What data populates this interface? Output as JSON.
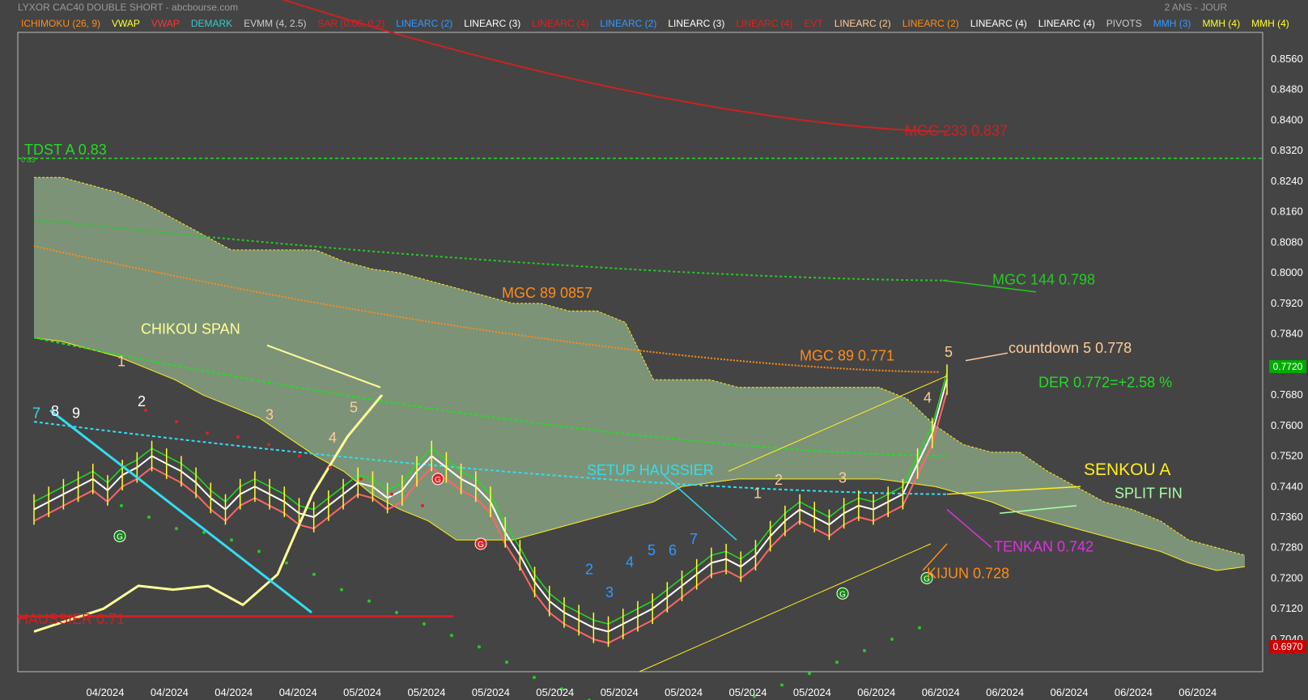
{
  "header": {
    "title": "LYXOR CAC40 DOUBLE SHORT - abcbourse.com",
    "period": "2 ANS - JOUR"
  },
  "legend": [
    {
      "label": "ICHIMOKU (26, 9)",
      "color": "#ff8c1a"
    },
    {
      "label": "VWAP",
      "color": "#ffff33"
    },
    {
      "label": "VWAP",
      "color": "#ff3333"
    },
    {
      "label": "DEMARK",
      "color": "#33cccc"
    },
    {
      "label": "EVMM (4, 2.5)",
      "color": "#cccccc"
    },
    {
      "label": "SAR (0.06, 0.2)",
      "color": "#dd2222"
    },
    {
      "label": "LINEARC (2)",
      "color": "#3399ff"
    },
    {
      "label": "LINEARC (3)",
      "color": "#ffffff"
    },
    {
      "label": "LINEARC (4)",
      "color": "#dd2222"
    },
    {
      "label": "LINEARC (2)",
      "color": "#3399ff"
    },
    {
      "label": "LINEARC (3)",
      "color": "#ffffff"
    },
    {
      "label": "LINEARC (4)",
      "color": "#dd2222"
    },
    {
      "label": "EVT",
      "color": "#dd2222"
    },
    {
      "label": "LINEARC (2)",
      "color": "#ffcc99"
    },
    {
      "label": "LINEARC (2)",
      "color": "#ff8c1a"
    },
    {
      "label": "LINEARC (4)",
      "color": "#ffffff"
    },
    {
      "label": "LINEARC (4)",
      "color": "#ffffff"
    },
    {
      "label": "PIVOTS",
      "color": "#cccccc"
    },
    {
      "label": "MMH (3)",
      "color": "#3399ff"
    },
    {
      "label": "MMH (4)",
      "color": "#ffff33"
    },
    {
      "label": "MMH (4)",
      "color": "#ffff33"
    }
  ],
  "price_badges": {
    "current": "0.7720",
    "current_color": "#00aa00",
    "low": "0.6970",
    "low_color": "#cc0000"
  },
  "chart_data": {
    "type": "line",
    "y_axis_ticks": [
      0.856,
      0.848,
      0.84,
      0.832,
      0.824,
      0.816,
      0.808,
      0.8,
      0.792,
      0.784,
      0.776,
      0.768,
      0.76,
      0.752,
      0.744,
      0.736,
      0.728,
      0.72,
      0.712,
      0.704
    ],
    "y_tick_labels": [
      "0.8560",
      "0.8480",
      "0.8400",
      "0.8320",
      "0.8240",
      "0.8160",
      "0.8080",
      "0.8000",
      "0.7920",
      "0.7840",
      "0.7760",
      "0.7680",
      "0.7600",
      "0.7520",
      "0.7440",
      "0.7360",
      "0.7280",
      "0.7200",
      "0.7120",
      "0.7040"
    ],
    "ylim": [
      0.6955,
      0.863
    ],
    "x_tick_labels": [
      "04/2024",
      "04/2024",
      "04/2024",
      "04/2024",
      "05/2024",
      "05/2024",
      "05/2024",
      "05/2024",
      "05/2024",
      "05/2024",
      "05/2024",
      "05/2024",
      "06/2024",
      "06/2024",
      "06/2024",
      "06/2024",
      "06/2024",
      "06/2024"
    ],
    "grid": false,
    "close": [
      0.738,
      0.74,
      0.742,
      0.744,
      0.746,
      0.743,
      0.747,
      0.749,
      0.752,
      0.75,
      0.748,
      0.745,
      0.741,
      0.738,
      0.742,
      0.744,
      0.742,
      0.74,
      0.737,
      0.736,
      0.739,
      0.742,
      0.745,
      0.744,
      0.741,
      0.743,
      0.748,
      0.752,
      0.749,
      0.746,
      0.744,
      0.74,
      0.732,
      0.726,
      0.719,
      0.714,
      0.711,
      0.709,
      0.707,
      0.706,
      0.708,
      0.71,
      0.712,
      0.715,
      0.718,
      0.721,
      0.724,
      0.725,
      0.723,
      0.726,
      0.731,
      0.735,
      0.738,
      0.736,
      0.734,
      0.737,
      0.739,
      0.738,
      0.74,
      0.742,
      0.75,
      0.758,
      0.772
    ],
    "cloud_upper": [
      0.825,
      0.825,
      0.823,
      0.821,
      0.818,
      0.814,
      0.81,
      0.806,
      0.806,
      0.806,
      0.806,
      0.803,
      0.801,
      0.8,
      0.798,
      0.796,
      0.794,
      0.792,
      0.792,
      0.79,
      0.79,
      0.787,
      0.772,
      0.772,
      0.772,
      0.77,
      0.77,
      0.77,
      0.77,
      0.77,
      0.77,
      0.767,
      0.76,
      0.755,
      0.753,
      0.753,
      0.748,
      0.744,
      0.74,
      0.738,
      0.735,
      0.73,
      0.728,
      0.726
    ],
    "cloud_lower": [
      0.783,
      0.782,
      0.78,
      0.778,
      0.775,
      0.772,
      0.768,
      0.765,
      0.762,
      0.757,
      0.752,
      0.748,
      0.742,
      0.738,
      0.735,
      0.73,
      0.73,
      0.73,
      0.732,
      0.734,
      0.736,
      0.738,
      0.74,
      0.744,
      0.745,
      0.746,
      0.746,
      0.746,
      0.746,
      0.746,
      0.746,
      0.745,
      0.744,
      0.742,
      0.74,
      0.737,
      0.735,
      0.733,
      0.731,
      0.729,
      0.727,
      0.724,
      0.722,
      0.723
    ],
    "series": [
      {
        "name": "MGC 233",
        "value": 0.837
      },
      {
        "name": "MGC 144",
        "value": 0.798
      },
      {
        "name": "MGC 89",
        "value": 0.771
      },
      {
        "name": "TENKAN",
        "value": 0.742
      },
      {
        "name": "KIJUN",
        "value": 0.728
      },
      {
        "name": "TDST A",
        "value": 0.83
      },
      {
        "name": "TDST B",
        "value": 0.71
      }
    ],
    "annotations": {
      "tdst_a": "TDST A 0.83",
      "tdst_a_small": "0.83",
      "tdst_b": "HAUSSIER 0.71",
      "mgc233": "MGC 233 0.837",
      "mgc144": "MGC 144 0.798",
      "mgc89_upper": "MGC 89 0857",
      "mgc89": "MGC 89 0.771",
      "chikou": "CHIKOU SPAN",
      "countdown": "countdown 5 0.778",
      "der": "DER 0.772=+2.58 %",
      "setup": "SETUP HAUSSIER",
      "senkou": "SENKOU A",
      "split": "SPLIT FIN",
      "tenkan": "TENKAN 0.742",
      "kijun": "KIJUN 0.728"
    },
    "demark_counts": [
      "1",
      "2",
      "3",
      "4",
      "5",
      "1",
      "2",
      "3",
      "4",
      "5",
      "2",
      "3",
      "4",
      "5",
      "6",
      "7",
      "7",
      "8",
      "9"
    ],
    "signal_markers": [
      "G",
      "G",
      "G",
      "G",
      "G"
    ]
  },
  "colors": {
    "background": "#444444",
    "cloud": "#8fae88",
    "tdst_a": "#22dd22",
    "tdst_b": "#cc2222",
    "mgc233": "#cc2222",
    "mgc144": "#22cc22",
    "mgc89": "#ff8c1a",
    "tenkan": "#dd33dd",
    "kijun": "#ff8c1a",
    "chikou": "#ffff99",
    "setup": "#33ddee",
    "senkou": "#ffee22",
    "split": "#aaffaa",
    "countdown": "#ffcc99",
    "der": "#22dd22"
  }
}
